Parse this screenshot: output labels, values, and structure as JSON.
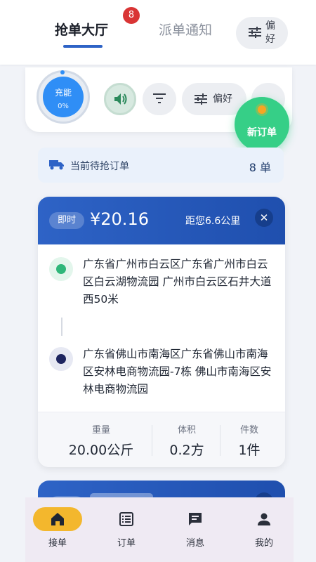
{
  "header": {
    "tab_active": "抢单大厅",
    "badge_count": "8",
    "tab_inactive": "派单通知",
    "pref_label": "偏好"
  },
  "controls": {
    "charge_label": "充能",
    "charge_percent": "0%",
    "pref_label": "偏好",
    "new_order_label": "新订单"
  },
  "pending": {
    "label": "当前待抢订单",
    "count": "8 单"
  },
  "order": {
    "tag": "即时",
    "price": "¥20.16",
    "distance": "距您6.6公里",
    "pickup": "广东省广州市白云区广东省广州市白云区白云湖物流园 广州市白云区石井大道西50米",
    "dropoff": "广东省佛山市南海区广东省佛山市南海区安林电商物流园-7栋 佛山市南海区安林电商物流园",
    "weight_label": "重量",
    "weight_value": "20.00公斤",
    "volume_label": "体积",
    "volume_value": "0.2方",
    "count_label": "件数",
    "count_value": "1件"
  },
  "nav": {
    "grab": "接单",
    "orders": "订单",
    "messages": "消息",
    "mine": "我的"
  },
  "colors": {
    "primary": "#2e63c6",
    "accent_green": "#36cf87",
    "badge_red": "#d93535",
    "nav_active": "#f3b72d"
  }
}
